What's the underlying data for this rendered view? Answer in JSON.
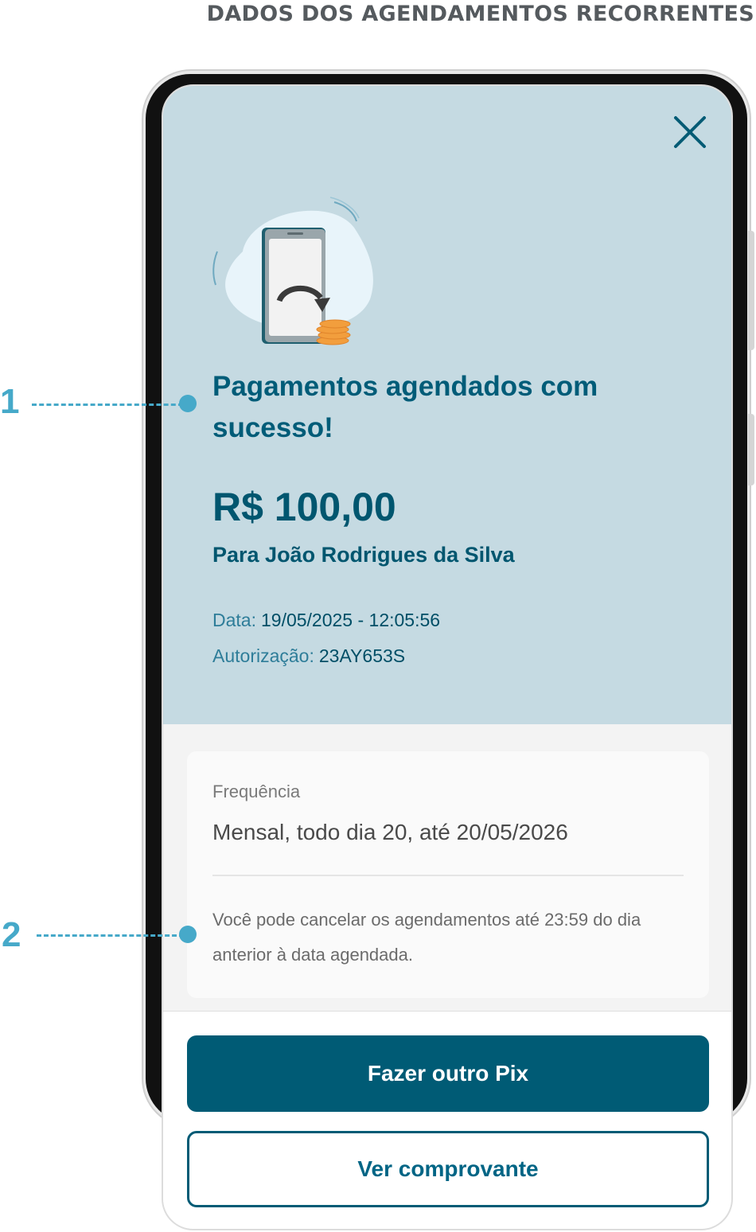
{
  "doc_title": "DADOS DOS AGENDAMENTOS RECORRENTES",
  "callouts": [
    "1",
    "2"
  ],
  "icons": {
    "close": "close-icon",
    "illustration": "phone-with-coins-illustration"
  },
  "success": {
    "title": "Pagamentos agendados com sucesso!",
    "amount": "R$ 100,00",
    "recipient": "Para João Rodrigues da Silva",
    "date_label": "Data:",
    "date_value": "19/05/2025 - 12:05:56",
    "auth_label": "Autorização:",
    "auth_value": "23AY653S"
  },
  "frequency_card": {
    "label": "Frequência",
    "value": "Mensal, todo dia 20, até 20/05/2026",
    "note": "Você pode cancelar os agendamentos até 23:59 do dia anterior à data agendada."
  },
  "actions": {
    "primary": "Fazer outro Pix",
    "secondary": "Ver comprovante"
  },
  "colors": {
    "primary": "#005b75",
    "hero_bg": "#c5dae2",
    "callout": "#46a9c9"
  }
}
